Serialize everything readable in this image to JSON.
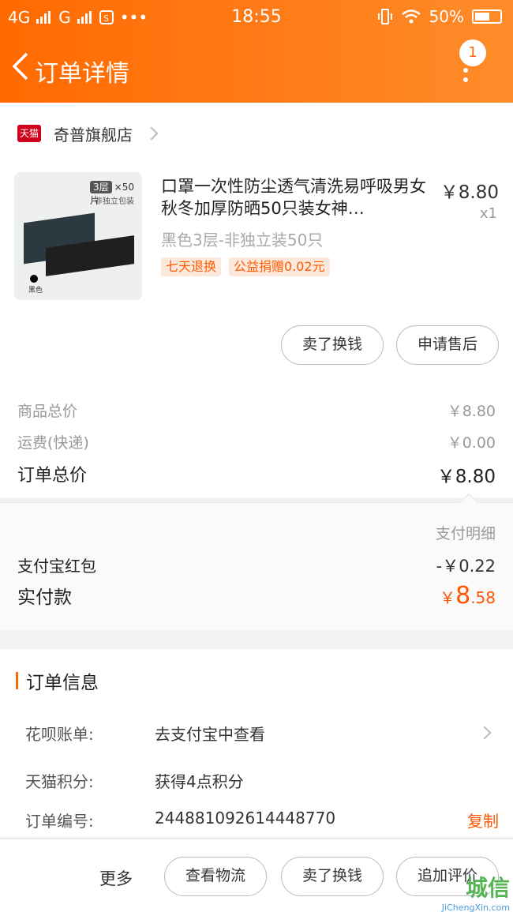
{
  "status_bar": {
    "network": "4G",
    "network2": "G",
    "time": "18:55",
    "battery": "50%"
  },
  "nav": {
    "title": "订单详情",
    "badge": "1"
  },
  "shop": {
    "platform_badge": "天猫",
    "name": "奇普旗舰店"
  },
  "product": {
    "title": "口罩一次性防尘透气清洗易呼吸男女秋冬加厚防晒50只装女神…",
    "price": "￥8.80",
    "quantity": "x1",
    "variant": "黑色3层-非独立装50只",
    "tags": [
      "七天退换",
      "公益捐赠0.02元"
    ],
    "image": {
      "layer_tag": "3层",
      "pack": "×50片",
      "sub": "非独立包装",
      "color_label": "黑色"
    }
  },
  "item_actions": {
    "sell": "卖了换钱",
    "after_sale": "申请售后"
  },
  "summary": {
    "goods_label": "商品总价",
    "goods_value": "￥8.80",
    "shipping_label": "运费(快递)",
    "shipping_value": "￥0.00",
    "total_label": "订单总价",
    "total_value": "￥8.80"
  },
  "payment": {
    "detail_label": "支付明细",
    "redpacket_label": "支付宝红包",
    "redpacket_value": "-￥0.22",
    "paid_label": "实付款",
    "paid_currency": "￥",
    "paid_int": "8",
    "paid_dec": ".58"
  },
  "order_info": {
    "title": "订单信息",
    "huabei_label": "花呗账单:",
    "huabei_value": "去支付宝中查看",
    "points_label": "天猫积分:",
    "points_value": "获得4点积分",
    "order_no_label": "订单编号:",
    "order_no_value": "244881092614448770",
    "copy_label": "复制"
  },
  "footer": {
    "more": "更多",
    "logistics": "查看物流",
    "sell": "卖了换钱",
    "review": "追加评价"
  },
  "watermark": {
    "text": "城信",
    "url": "JiChengXin.com"
  },
  "colors": {
    "accent": "#ff6a00",
    "price_highlight": "#ff5500",
    "tag_bg": "#fde8dc"
  }
}
